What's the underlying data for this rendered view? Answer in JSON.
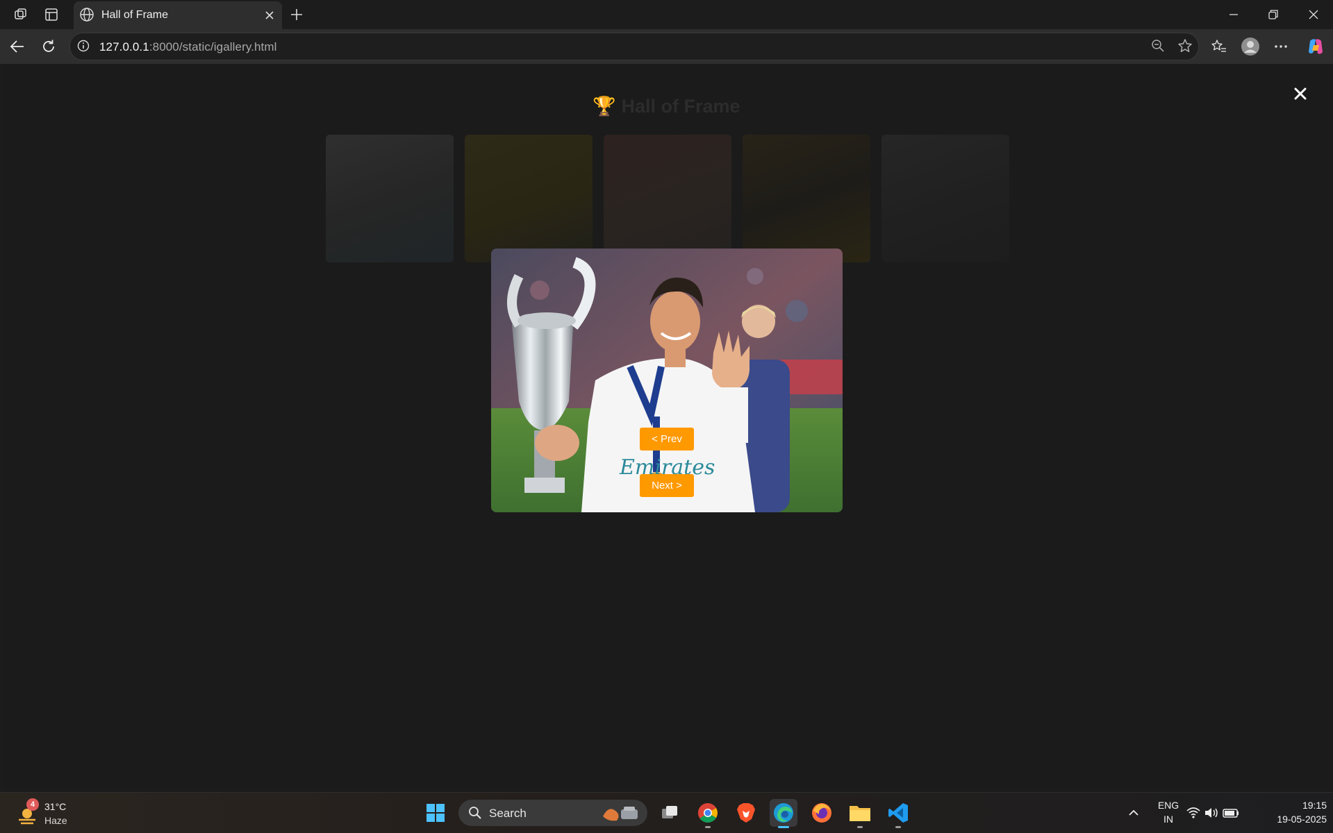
{
  "browser": {
    "tab": {
      "title": "Hall of Frame"
    },
    "address": {
      "host": "127.0.0.1",
      "rest": ":8000/static/igallery.html"
    }
  },
  "page": {
    "title": "🏆 Hall of Frame",
    "close_symbol": "✕",
    "prev_label": "< Prev",
    "next_label": "Next >",
    "thumbnail_count": 5
  },
  "taskbar": {
    "weather": {
      "badge": "4",
      "temp": "31°C",
      "condition": "Haze"
    },
    "search_label": "Search",
    "language": {
      "line1": "ENG",
      "line2": "IN"
    },
    "time": "19:15",
    "date": "19-05-2025"
  },
  "colors": {
    "accent_button": "#ff9900",
    "page_background": "#1b1b1b",
    "chrome_background": "#2e2e2e"
  }
}
